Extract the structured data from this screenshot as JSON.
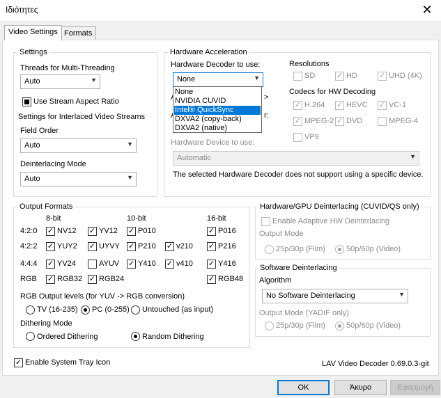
{
  "window": {
    "title": "Ιδιότητες",
    "close_glyph": "✕"
  },
  "tabs": [
    {
      "label": "Video Settings",
      "active": true
    },
    {
      "label": "Formats",
      "active": false
    }
  ],
  "settings": {
    "group_label": "Settings",
    "threads_label": "Threads for Multi-Threading",
    "threads_value": "Auto",
    "stream_aspect_label": "Use Stream Aspect Ratio",
    "stream_aspect_state": "indeterminate",
    "interlaced_label": "Settings for Interlaced Video Streams",
    "field_order_label": "Field Order",
    "field_order_value": "Auto",
    "deint_mode_label": "Deinterlacing Mode",
    "deint_mode_value": "Auto"
  },
  "hwaccel": {
    "group_label": "Hardware Acceleration",
    "decoder_label": "Hardware Decoder to use:",
    "decoder_value": "None",
    "decoder_options": [
      "None",
      "NVIDIA CUVID",
      "Intel® QuickSync",
      "DXVA2 (copy-back)",
      "DXVA2 (native)"
    ],
    "decoder_highlighted_index": 2,
    "hidden_label_a": "A",
    "hidden_label_a_suffix": ">",
    "hidden_label_b": "A",
    "hidden_label_b_suffix": "r:",
    "device_label": "Hardware Device to use:",
    "device_value": "Automatic",
    "device_note": "The selected Hardware Decoder does not support using a specific device.",
    "resolutions_label": "Resolutions",
    "resolutions": [
      {
        "label": "SD",
        "checked": false
      },
      {
        "label": "HD",
        "checked": true
      },
      {
        "label": "UHD (4K)",
        "checked": true
      }
    ],
    "codecs_label": "Codecs for HW Decoding",
    "codecs": [
      {
        "label": "H.264",
        "checked": true
      },
      {
        "label": "HEVC",
        "checked": true
      },
      {
        "label": "VC-1",
        "checked": true
      },
      {
        "label": "MPEG-2",
        "checked": true
      },
      {
        "label": "DVD",
        "checked": true
      },
      {
        "label": "MPEG-4",
        "checked": false
      },
      {
        "label": "VP9",
        "checked": false
      }
    ]
  },
  "output_formats": {
    "group_label": "Output Formats",
    "col_headers": [
      "8-bit",
      "10-bit",
      "16-bit"
    ],
    "rows": [
      {
        "label": "4:2:0",
        "items": [
          {
            "label": "NV12",
            "checked": true
          },
          {
            "label": "YV12",
            "checked": true
          },
          {
            "label": "P010",
            "checked": true
          },
          {
            "label": "P016",
            "checked": true
          }
        ]
      },
      {
        "label": "4:2:2",
        "items": [
          {
            "label": "YUY2",
            "checked": true
          },
          {
            "label": "UYVY",
            "checked": true
          },
          {
            "label": "P210",
            "checked": true
          },
          {
            "label": "v210",
            "checked": true
          },
          {
            "label": "P216",
            "checked": true
          }
        ]
      },
      {
        "label": "4:4:4",
        "items": [
          {
            "label": "YV24",
            "checked": true
          },
          {
            "label": "AYUV",
            "checked": false
          },
          {
            "label": "Y410",
            "checked": true
          },
          {
            "label": "v410",
            "checked": true
          },
          {
            "label": "Y416",
            "checked": true
          }
        ]
      },
      {
        "label": "RGB",
        "items": [
          {
            "label": "RGB32",
            "checked": true
          },
          {
            "label": "RGB24",
            "checked": true
          },
          {
            "label": "RGB48",
            "checked": true
          }
        ]
      }
    ],
    "rgb_levels_label": "RGB Output levels (for YUV -> RGB conversion)",
    "rgb_levels": [
      {
        "label": "TV (16-235)",
        "selected": false
      },
      {
        "label": "PC (0-255)",
        "selected": true
      },
      {
        "label": "Untouched (as input)",
        "selected": false
      }
    ],
    "dithering_label": "Dithering Mode",
    "dithering": [
      {
        "label": "Ordered Dithering",
        "selected": false
      },
      {
        "label": "Random Dithering",
        "selected": true
      }
    ]
  },
  "hw_deint": {
    "group_label": "Hardware/GPU Deinterlacing (CUVID/QS only)",
    "enable_label": "Enable Adaptive HW Deinterlacing",
    "output_mode_label": "Output Mode",
    "modes": [
      {
        "label": "25p/30p (Film)",
        "selected": false
      },
      {
        "label": "50p/60p (Video)",
        "selected": true
      }
    ]
  },
  "sw_deint": {
    "group_label": "Software Deinterlacing",
    "algorithm_label": "Algorithm",
    "algorithm_value": "No Software Deinterlacing",
    "output_mode_label": "Output Mode (YADIF only)",
    "modes": [
      {
        "label": "25p/30p (Film)",
        "selected": false
      },
      {
        "label": "50p/60p (Video)",
        "selected": true
      }
    ]
  },
  "footer": {
    "tray_label": "Enable System Tray Icon",
    "tray_checked": true,
    "version": "LAV Video Decoder 0.69.0.3-git"
  },
  "buttons": {
    "ok": "OK",
    "cancel": "Άκυρο",
    "apply": "Εφαρμογή"
  },
  "glyphs": {
    "check": "✓",
    "arrow": "▼"
  }
}
